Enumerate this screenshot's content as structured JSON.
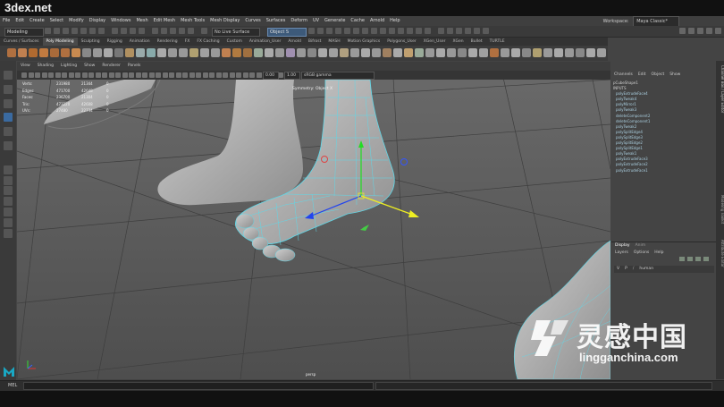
{
  "watermark": {
    "top": "3dex.net",
    "chinese": "灵感中国",
    "url": "lingganchina.com"
  },
  "menubar": [
    "File",
    "Edit",
    "Create",
    "Select",
    "Modify",
    "Display",
    "Windows",
    "Mesh",
    "Edit Mesh",
    "Mesh Tools",
    "Mesh Display",
    "Curves",
    "Surfaces",
    "Deform",
    "UV",
    "Generate",
    "Cache",
    "Arnold",
    "Help"
  ],
  "workspace": {
    "label": "Workspace:",
    "value": "Maya Classic*"
  },
  "status_line": {
    "mode": "Modeling",
    "live_surface": "No Live Surface",
    "object": "Object S"
  },
  "shelf_tabs": [
    "Curves / Surfaces",
    "Poly Modeling",
    "Sculpting",
    "Rigging",
    "Animation",
    "Rendering",
    "FX",
    "FX Caching",
    "Custom",
    "Animation_User",
    "Arnold",
    "Bifrost",
    "MASH",
    "Motion Graphics",
    "Polygons_User",
    "XGen_User",
    "XGen",
    "Bullet",
    "TURTLE"
  ],
  "shelf_active": 1,
  "panel_menu": [
    "View",
    "Shading",
    "Lighting",
    "Show",
    "Renderer",
    "Panels"
  ],
  "panel_toolbar": {
    "value1": "0.00",
    "value2": "1.00",
    "colorspace": "sRGB gamma"
  },
  "hud": [
    {
      "label": "Verts:",
      "a": "231980",
      "b": "21344",
      "c": "0"
    },
    {
      "label": "Edges:",
      "a": "471700",
      "b": "42648",
      "c": "0"
    },
    {
      "label": "Faces:",
      "a": "236700",
      "b": "21304",
      "c": "0"
    },
    {
      "label": "Tris:",
      "a": "473220",
      "b": "42608",
      "c": "0"
    },
    {
      "label": "UVs:",
      "a": "27480",
      "b": "22734",
      "c": "0"
    }
  ],
  "symmetry": "Symmetry: Object X",
  "camera": "persp",
  "channel_box": {
    "menu": [
      "Channels",
      "Edit",
      "Object",
      "Show"
    ],
    "shape": "pCubeShape1",
    "inputs_label": "INPUTS",
    "inputs": [
      "polyExtrudeFace4",
      "polyTweak4",
      "polyMirror1",
      "polyTweak3",
      "deleteComponent2",
      "deleteComponent1",
      "polyTweak2",
      "polySplitEdge4",
      "polySplitEdge3",
      "polySplitEdge2",
      "polySplitEdge1",
      "polyTweak1",
      "polyExtrudeFace3",
      "polyExtrudeFace2",
      "polyExtrudeFace1"
    ]
  },
  "layer_editor": {
    "tabs": [
      "Display",
      "Anim"
    ],
    "menu": [
      "Layers",
      "Options",
      "Help"
    ],
    "layer": {
      "v": "V",
      "p": "P",
      "name": "human"
    }
  },
  "command_line": {
    "label": "MEL"
  },
  "right_tabs": [
    "Channel Box / Layer Editor",
    "Modeling Toolkit",
    "Attribute Editor"
  ]
}
